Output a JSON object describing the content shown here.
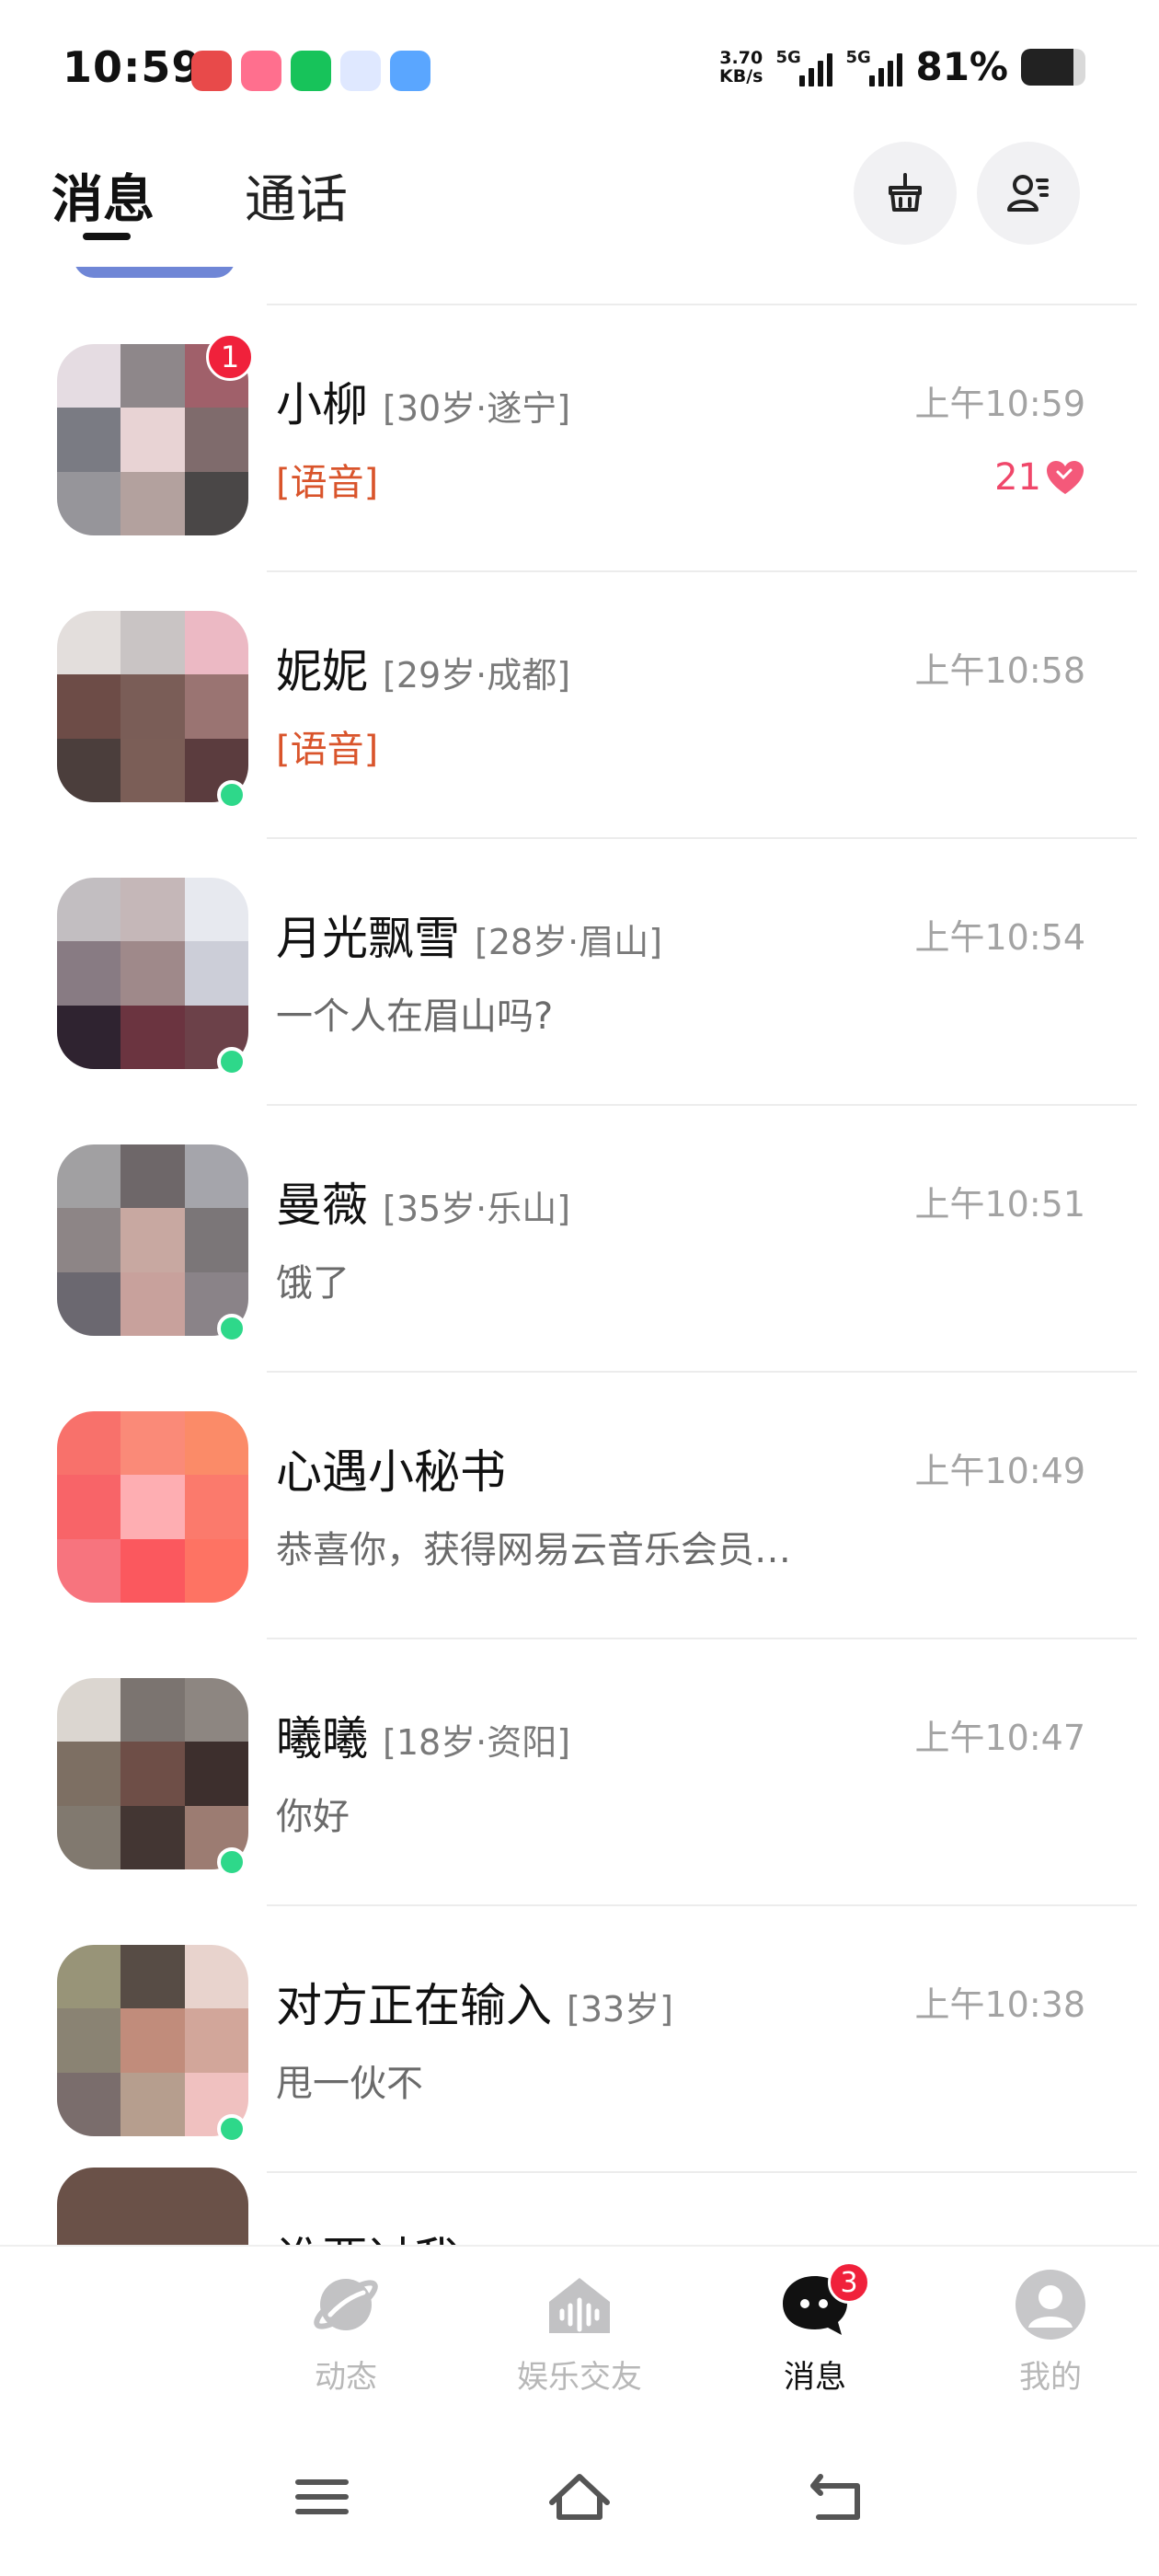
{
  "status_bar": {
    "time": "10:59",
    "speed_value": "3.70",
    "speed_unit": "KB/s",
    "net1": "5G",
    "net2": "5G",
    "battery_text": "81%",
    "battery_level": 0.81,
    "app_colors": [
      "#e84a4a",
      "#ff6f8e",
      "#17c35a",
      "#5aa6ff",
      "#f6b93b"
    ]
  },
  "header": {
    "tab_messages": "消息",
    "tab_calls": "通话",
    "active_tab": "消息",
    "clean_icon": "broom-basket-icon",
    "contacts_icon": "contacts-icon"
  },
  "conversations": [
    {
      "name": "小柳",
      "meta": "[30岁·遂宁]",
      "time": "上午10:59",
      "preview": "[语音]",
      "voice": true,
      "unread": "1",
      "online": false,
      "hearts": "21",
      "avatar": [
        "#e5dce2",
        "#8e878a",
        "#a0606a",
        "#7a7b83",
        "#e8d3d4",
        "#7f6b6c",
        "#96959a",
        "#b3a19e",
        "#4a4747"
      ]
    },
    {
      "name": "妮妮",
      "meta": "[29岁·成都]",
      "time": "上午10:58",
      "preview": "[语音]",
      "voice": true,
      "online": true,
      "avatar": [
        "#e3dedc",
        "#c9c4c4",
        "#ecb9c4",
        "#6d4c47",
        "#7a5d57",
        "#9a7472",
        "#4b3e3c",
        "#7b5e57",
        "#5b3c3e"
      ]
    },
    {
      "name": "月光飘雪",
      "meta": "[28岁·眉山]",
      "time": "上午10:54",
      "preview": "一个人在眉山吗?",
      "voice": false,
      "online": true,
      "avatar": [
        "#c2bec1",
        "#c5b7b8",
        "#e7e9ef",
        "#887b83",
        "#9f898a",
        "#ccced8",
        "#2f2330",
        "#6b3440",
        "#6c4149"
      ]
    },
    {
      "name": "曼薇",
      "meta": "[35岁·乐山]",
      "time": "上午10:51",
      "preview": "饿了",
      "voice": false,
      "online": true,
      "avatar": [
        "#a1a0a2",
        "#6e6769",
        "#a5a5ab",
        "#8d8586",
        "#c8a8a1",
        "#7b7678",
        "#6b6870",
        "#c8a19c",
        "#8a8388"
      ]
    },
    {
      "name": "心遇小秘书",
      "meta": "",
      "time": "上午10:49",
      "preview": "恭喜你，获得网易云音乐会员…",
      "voice": false,
      "online": false,
      "avatar": [
        "#f8716b",
        "#fa8a78",
        "#fb8b68",
        "#f86468",
        "#feaeb2",
        "#fb7a6c",
        "#f7747e",
        "#fb585e",
        "#fe7363"
      ]
    },
    {
      "name": "曦曦",
      "meta": "[18岁·资阳]",
      "time": "上午10:47",
      "preview": "你好",
      "voice": false,
      "online": true,
      "avatar": [
        "#dbd6d0",
        "#7b7470",
        "#8d8681",
        "#7d6f63",
        "#6e4e47",
        "#3d2f2d",
        "#81796f",
        "#433633",
        "#9c7c72"
      ]
    },
    {
      "name": "对方正在输入",
      "meta": "[33岁]",
      "time": "上午10:38",
      "preview": "甩一伙不",
      "voice": false,
      "online": true,
      "avatar": [
        "#989478",
        "#574c45",
        "#e8d3cd",
        "#8a8373",
        "#c18c7b",
        "#d2a69a",
        "#7a6d6c",
        "#b69e8e",
        "#f0c1c0"
      ]
    }
  ],
  "next_name_peek": "谁要过我",
  "bottom_nav": [
    {
      "label": "动态",
      "icon": "planet-icon",
      "active": false
    },
    {
      "label": "娱乐交友",
      "icon": "voice-room-icon",
      "active": false
    },
    {
      "label": "消息",
      "icon": "chat-bubble-icon",
      "active": true,
      "badge": "3"
    },
    {
      "label": "我的",
      "icon": "profile-icon",
      "active": false
    }
  ],
  "system_nav": {
    "menu_icon": "menu-icon",
    "home_icon": "home-icon",
    "back_icon": "back-icon"
  }
}
